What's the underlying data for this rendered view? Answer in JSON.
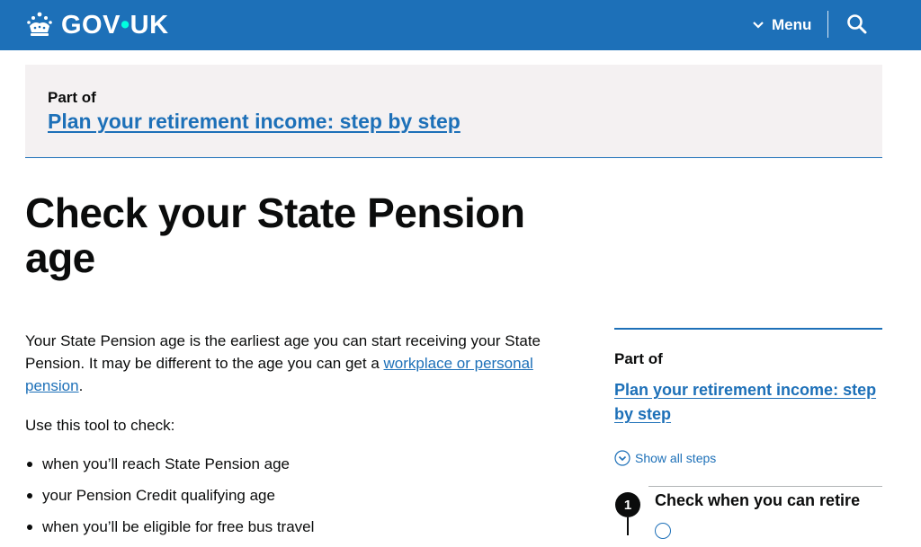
{
  "header": {
    "logo_text_left": "GOV",
    "logo_dot": "•",
    "logo_text_right": "UK",
    "menu_label": "Menu",
    "icons": [
      "crown-icon",
      "chevron-down-icon",
      "search-icon"
    ],
    "brand_color": "#1d70b8"
  },
  "banner": {
    "label": "Part of",
    "link": "Plan your retirement income: step by step"
  },
  "main": {
    "title": "Check your State Pension age",
    "intro_before": "Your State Pension age is the earliest age you can start receiving your State Pension. It may be different to the age you can get a ",
    "intro_link": "workplace or personal pension",
    "intro_after": ".",
    "use_text": "Use this tool to check:",
    "bullets": [
      "when you’ll reach State Pension age",
      "your Pension Credit qualifying age",
      "when you’ll be eligible for free bus travel"
    ]
  },
  "sidebar": {
    "label": "Part of",
    "link": "Plan your retirement income: step by step",
    "show_all": "Show all steps",
    "steps": [
      {
        "number": "1",
        "title": "Check when you can retire"
      }
    ]
  }
}
